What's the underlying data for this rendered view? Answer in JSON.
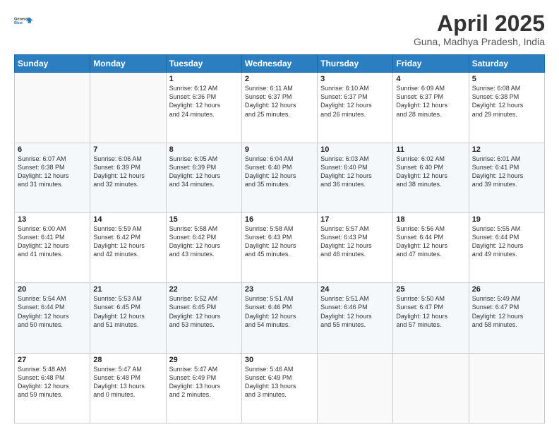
{
  "header": {
    "logo_line1": "General",
    "logo_line2": "Blue",
    "title": "April 2025",
    "subtitle": "Guna, Madhya Pradesh, India"
  },
  "weekdays": [
    "Sunday",
    "Monday",
    "Tuesday",
    "Wednesday",
    "Thursday",
    "Friday",
    "Saturday"
  ],
  "weeks": [
    [
      {
        "day": "",
        "info": ""
      },
      {
        "day": "",
        "info": ""
      },
      {
        "day": "1",
        "info": "Sunrise: 6:12 AM\nSunset: 6:36 PM\nDaylight: 12 hours\nand 24 minutes."
      },
      {
        "day": "2",
        "info": "Sunrise: 6:11 AM\nSunset: 6:37 PM\nDaylight: 12 hours\nand 25 minutes."
      },
      {
        "day": "3",
        "info": "Sunrise: 6:10 AM\nSunset: 6:37 PM\nDaylight: 12 hours\nand 26 minutes."
      },
      {
        "day": "4",
        "info": "Sunrise: 6:09 AM\nSunset: 6:37 PM\nDaylight: 12 hours\nand 28 minutes."
      },
      {
        "day": "5",
        "info": "Sunrise: 6:08 AM\nSunset: 6:38 PM\nDaylight: 12 hours\nand 29 minutes."
      }
    ],
    [
      {
        "day": "6",
        "info": "Sunrise: 6:07 AM\nSunset: 6:38 PM\nDaylight: 12 hours\nand 31 minutes."
      },
      {
        "day": "7",
        "info": "Sunrise: 6:06 AM\nSunset: 6:39 PM\nDaylight: 12 hours\nand 32 minutes."
      },
      {
        "day": "8",
        "info": "Sunrise: 6:05 AM\nSunset: 6:39 PM\nDaylight: 12 hours\nand 34 minutes."
      },
      {
        "day": "9",
        "info": "Sunrise: 6:04 AM\nSunset: 6:40 PM\nDaylight: 12 hours\nand 35 minutes."
      },
      {
        "day": "10",
        "info": "Sunrise: 6:03 AM\nSunset: 6:40 PM\nDaylight: 12 hours\nand 36 minutes."
      },
      {
        "day": "11",
        "info": "Sunrise: 6:02 AM\nSunset: 6:40 PM\nDaylight: 12 hours\nand 38 minutes."
      },
      {
        "day": "12",
        "info": "Sunrise: 6:01 AM\nSunset: 6:41 PM\nDaylight: 12 hours\nand 39 minutes."
      }
    ],
    [
      {
        "day": "13",
        "info": "Sunrise: 6:00 AM\nSunset: 6:41 PM\nDaylight: 12 hours\nand 41 minutes."
      },
      {
        "day": "14",
        "info": "Sunrise: 5:59 AM\nSunset: 6:42 PM\nDaylight: 12 hours\nand 42 minutes."
      },
      {
        "day": "15",
        "info": "Sunrise: 5:58 AM\nSunset: 6:42 PM\nDaylight: 12 hours\nand 43 minutes."
      },
      {
        "day": "16",
        "info": "Sunrise: 5:58 AM\nSunset: 6:43 PM\nDaylight: 12 hours\nand 45 minutes."
      },
      {
        "day": "17",
        "info": "Sunrise: 5:57 AM\nSunset: 6:43 PM\nDaylight: 12 hours\nand 46 minutes."
      },
      {
        "day": "18",
        "info": "Sunrise: 5:56 AM\nSunset: 6:44 PM\nDaylight: 12 hours\nand 47 minutes."
      },
      {
        "day": "19",
        "info": "Sunrise: 5:55 AM\nSunset: 6:44 PM\nDaylight: 12 hours\nand 49 minutes."
      }
    ],
    [
      {
        "day": "20",
        "info": "Sunrise: 5:54 AM\nSunset: 6:44 PM\nDaylight: 12 hours\nand 50 minutes."
      },
      {
        "day": "21",
        "info": "Sunrise: 5:53 AM\nSunset: 6:45 PM\nDaylight: 12 hours\nand 51 minutes."
      },
      {
        "day": "22",
        "info": "Sunrise: 5:52 AM\nSunset: 6:45 PM\nDaylight: 12 hours\nand 53 minutes."
      },
      {
        "day": "23",
        "info": "Sunrise: 5:51 AM\nSunset: 6:46 PM\nDaylight: 12 hours\nand 54 minutes."
      },
      {
        "day": "24",
        "info": "Sunrise: 5:51 AM\nSunset: 6:46 PM\nDaylight: 12 hours\nand 55 minutes."
      },
      {
        "day": "25",
        "info": "Sunrise: 5:50 AM\nSunset: 6:47 PM\nDaylight: 12 hours\nand 57 minutes."
      },
      {
        "day": "26",
        "info": "Sunrise: 5:49 AM\nSunset: 6:47 PM\nDaylight: 12 hours\nand 58 minutes."
      }
    ],
    [
      {
        "day": "27",
        "info": "Sunrise: 5:48 AM\nSunset: 6:48 PM\nDaylight: 12 hours\nand 59 minutes."
      },
      {
        "day": "28",
        "info": "Sunrise: 5:47 AM\nSunset: 6:48 PM\nDaylight: 13 hours\nand 0 minutes."
      },
      {
        "day": "29",
        "info": "Sunrise: 5:47 AM\nSunset: 6:49 PM\nDaylight: 13 hours\nand 2 minutes."
      },
      {
        "day": "30",
        "info": "Sunrise: 5:46 AM\nSunset: 6:49 PM\nDaylight: 13 hours\nand 3 minutes."
      },
      {
        "day": "",
        "info": ""
      },
      {
        "day": "",
        "info": ""
      },
      {
        "day": "",
        "info": ""
      }
    ]
  ]
}
